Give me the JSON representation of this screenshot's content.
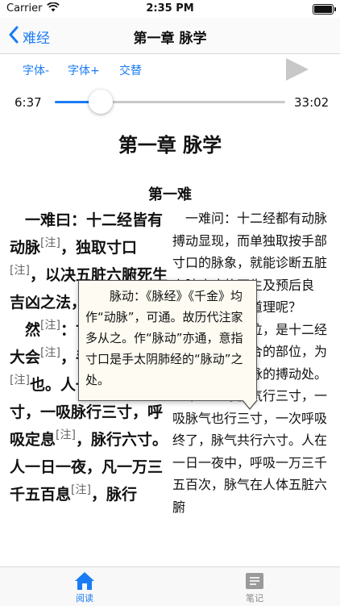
{
  "status": {
    "carrier": "Carrier",
    "time": "2:35 PM"
  },
  "nav": {
    "back_label": "难经",
    "title": "第一章 脉学"
  },
  "toolbar": {
    "font_smaller": "字体-",
    "font_larger": "字体+",
    "alternate": "交替"
  },
  "player": {
    "elapsed": "6:37",
    "total": "33:02",
    "progress": 0.2
  },
  "content": {
    "chapter_title": "第一章 脉学",
    "section_title": "第一难",
    "original": {
      "p1_a": "一难曰：十二经皆有动脉",
      "note": "[注]",
      "p1_b": "，独取寸口",
      "p1_c": "，以决五脏六腑死生吉凶之法，何谓也？",
      "p2_a": "然",
      "p2_b": "：寸口者，脉之大会",
      "p2_c": "，手太阴之脉动",
      "p2_d": "也。人一呼脉行三寸，一吸脉行三寸，呼吸定息",
      "p2_e": "，脉行六寸。人一日一夜，凡一万三千五百息",
      "p2_f": "，脉行"
    },
    "translation": {
      "p1": "一难问：十二经都有动脉搏动显现，而单独取按手部寸口的脉象，就能诊断五脏六腑疾病的死生及预后良恶，这是什么道理呢？",
      "p2": "答：寸口部位，是十二经脉气聚集、会合的部位，为手太阴肺经经脉的搏动处。正常人一呼脉气行三寸，一吸脉气也行三寸，一次呼吸终了，脉气共行六寸。人在一日一夜中，呼吸一万三千五百次，脉气在人体五脏六腑"
    }
  },
  "popup": {
    "text": "脉动：《脉经》《千金》均作“动脉”，可通。故历代注家多从之。作“脉动”亦通，意指寸口是手太阴肺经的“脉动”之处。"
  },
  "tabbar": {
    "read_label": "阅读",
    "notes_label": "笔记"
  },
  "colors": {
    "accent": "#1a7cf5",
    "popup_bg": "#fdfbf2",
    "note": "#666666"
  }
}
